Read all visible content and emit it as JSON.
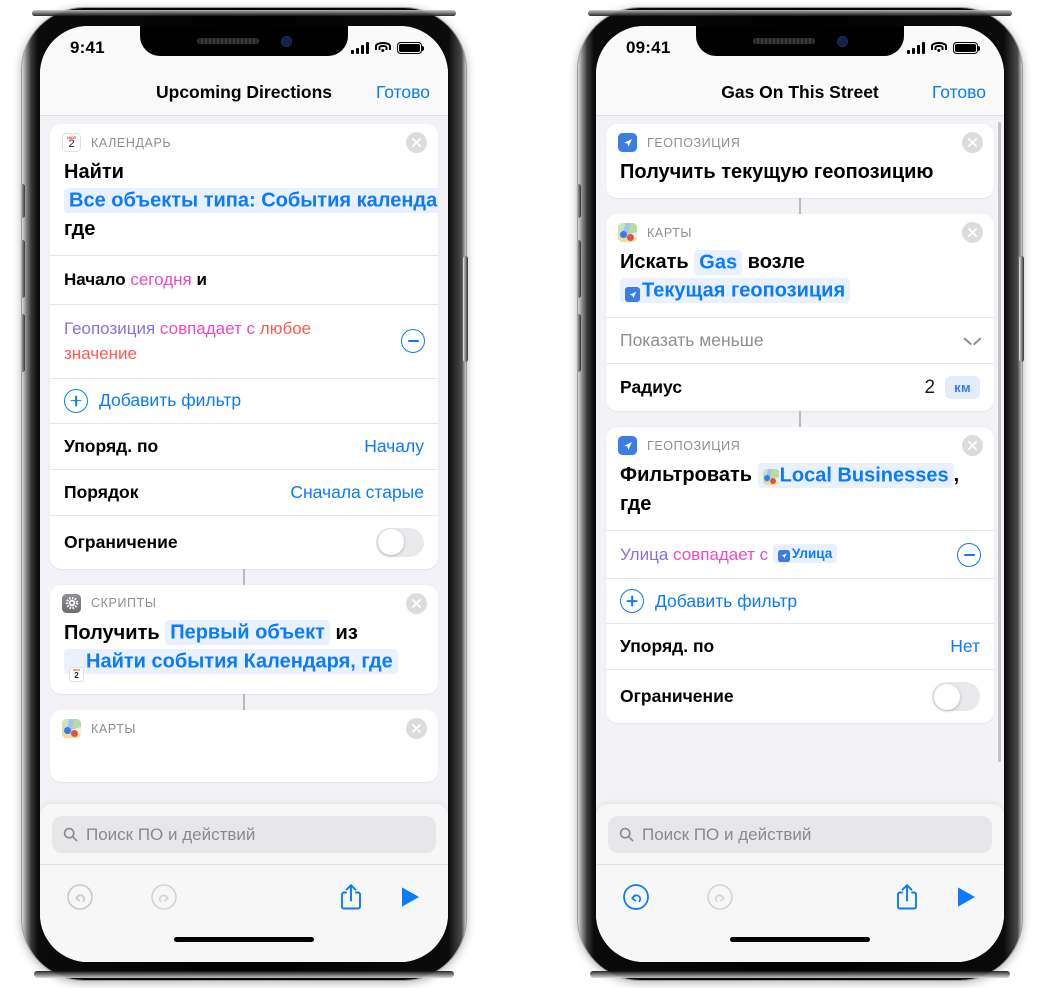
{
  "colors": {
    "accent": "#0a7aff",
    "token_bg": "#e9f1fe",
    "screen_bg": "#f2f2f7",
    "variable_purple": "#8a6fe0",
    "operator_pink": "#e84bc8",
    "value_red": "#ff5a4d",
    "muted_gray": "#8e8e93"
  },
  "phones": [
    {
      "id": "left",
      "status_bar": {
        "time": "9:41",
        "cellular": "signal-bars",
        "wifi": "wifi",
        "battery": "battery-full"
      },
      "nav": {
        "title": "Upcoming Directions",
        "done_label": "Готово"
      },
      "cards": [
        {
          "app": "КАЛЕНДАРЬ",
          "app_icon": "calendar-icon",
          "icon_day": "2",
          "close_icon": "close-icon",
          "body": [
            {
              "t": "text",
              "v": "Найти"
            },
            {
              "t": "token",
              "v": "Все объекты типа: События календаря"
            },
            {
              "t": "text",
              "v": ", где"
            }
          ],
          "filters": [
            {
              "var": "Начало",
              "op": "",
              "val": "сегодня",
              "tail": "и",
              "style": "start",
              "has_minus": false
            },
            {
              "var": "Геопозиция",
              "op": "совпадает с",
              "val": "любое значение",
              "tail": "",
              "style": "full",
              "has_minus": true
            }
          ],
          "add_filter": "Добавить фильтр",
          "rows": [
            {
              "label": "Упоряд. по",
              "value": "Началу",
              "kind": "value"
            },
            {
              "label": "Порядок",
              "value": "Сначала старые",
              "kind": "value"
            },
            {
              "label": "Ограничение",
              "value": "",
              "kind": "toggle",
              "toggle_on": false
            }
          ]
        },
        {
          "app": "СКРИПТЫ",
          "app_icon": "gear-icon",
          "close_icon": "close-icon",
          "body": [
            {
              "t": "text",
              "v": "Получить"
            },
            {
              "t": "token",
              "v": "Первый объект"
            },
            {
              "t": "text",
              "v": "из"
            },
            {
              "t": "token_icon",
              "v": "Найти события Календаря, где",
              "icon": "calendar-icon"
            }
          ]
        },
        {
          "app": "КАРТЫ",
          "app_icon": "maps-icon",
          "close_icon": "close-icon",
          "partial": true
        }
      ],
      "search": {
        "placeholder": "Поиск ПО и действий",
        "icon": "search-icon"
      },
      "toolbar": {
        "undo": {
          "icon": "undo-icon",
          "enabled": false
        },
        "redo": {
          "icon": "redo-icon",
          "enabled": false
        },
        "share": {
          "icon": "share-icon",
          "enabled": true
        },
        "run": {
          "icon": "play-icon",
          "enabled": true
        }
      }
    },
    {
      "id": "right",
      "status_bar": {
        "time": "09:41",
        "cellular": "signal-bars",
        "wifi": "wifi",
        "battery": "battery-full"
      },
      "nav": {
        "title": "Gas On This Street",
        "done_label": "Готово"
      },
      "cards": [
        {
          "app": "ГЕОПОЗИЦИЯ",
          "app_icon": "location-icon",
          "close_icon": "close-icon",
          "body": [
            {
              "t": "text",
              "v": "Получить текущую геопозицию"
            }
          ]
        },
        {
          "app": "КАРТЫ",
          "app_icon": "maps-icon",
          "close_icon": "close-icon",
          "body": [
            {
              "t": "text",
              "v": "Искать"
            },
            {
              "t": "token",
              "v": "Gas"
            },
            {
              "t": "text",
              "v": "возле"
            },
            {
              "t": "token_icon",
              "v": "Текущая геопозиция",
              "icon": "location-icon"
            }
          ],
          "rows": [
            {
              "label": "Показать меньше",
              "value": "",
              "kind": "disclosure",
              "icon": "chevron-down-icon"
            },
            {
              "label": "Радиус",
              "value": "2",
              "unit": "км",
              "kind": "stepper"
            }
          ]
        },
        {
          "app": "ГЕОПОЗИЦИЯ",
          "app_icon": "location-icon",
          "close_icon": "close-icon",
          "body": [
            {
              "t": "text",
              "v": "Фильтровать"
            },
            {
              "t": "token_icon",
              "v": "Local Businesses",
              "icon": "maps-icon"
            },
            {
              "t": "text",
              "v": ", где"
            }
          ],
          "filters": [
            {
              "var": "Улица",
              "op": "совпадает с",
              "val": "Улица",
              "val_is_token": true,
              "has_minus": true
            }
          ],
          "add_filter": "Добавить фильтр",
          "rows": [
            {
              "label": "Упоряд. по",
              "value": "Нет",
              "kind": "value"
            },
            {
              "label": "Ограничение",
              "value": "",
              "kind": "toggle",
              "toggle_on": false
            }
          ]
        }
      ],
      "search": {
        "placeholder": "Поиск ПО и действий",
        "icon": "search-icon"
      },
      "toolbar": {
        "undo": {
          "icon": "undo-icon",
          "enabled": true
        },
        "redo": {
          "icon": "redo-icon",
          "enabled": false
        },
        "share": {
          "icon": "share-icon",
          "enabled": true
        },
        "run": {
          "icon": "play-icon",
          "enabled": true
        }
      }
    }
  ]
}
